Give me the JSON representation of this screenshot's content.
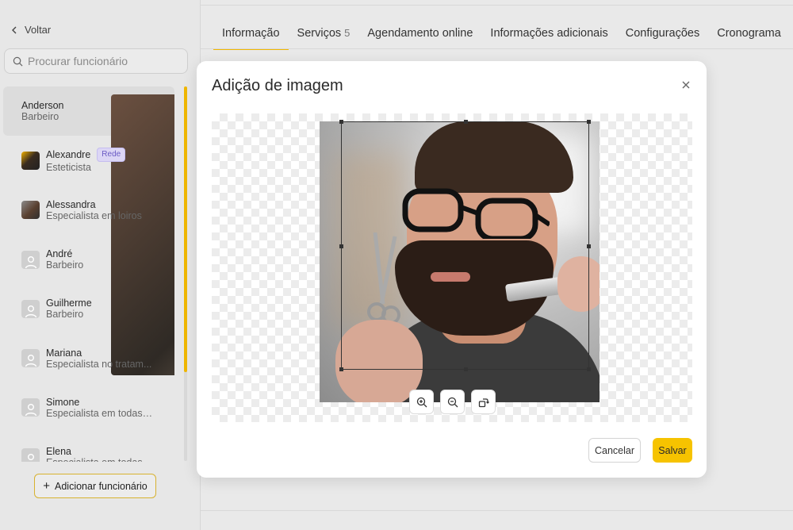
{
  "sidebar": {
    "back_label": "Voltar",
    "search_placeholder": "Procurar funcionário",
    "employees": [
      {
        "name": "Anderson",
        "role": "Barbeiro",
        "badge": ""
      },
      {
        "name": "Alexandre",
        "role": "Esteticista",
        "badge": "Rede"
      },
      {
        "name": "Alessandra",
        "role": "Especialista em loiros",
        "badge": ""
      },
      {
        "name": "André",
        "role": "Barbeiro",
        "badge": ""
      },
      {
        "name": "Guilherme",
        "role": "Barbeiro",
        "badge": ""
      },
      {
        "name": "Mariana",
        "role": "Especialista no tratam...",
        "badge": ""
      },
      {
        "name": "Simone",
        "role": "Especialista em todas ...",
        "badge": ""
      },
      {
        "name": "Elena",
        "role": "Especialista em todas",
        "badge": ""
      }
    ],
    "add_button_label": "Adicionar funcionário"
  },
  "tabs": [
    {
      "label": "Informação",
      "count": ""
    },
    {
      "label": "Serviços",
      "count": "5"
    },
    {
      "label": "Agendamento online",
      "count": ""
    },
    {
      "label": "Informações adicionais",
      "count": ""
    },
    {
      "label": "Configurações",
      "count": ""
    },
    {
      "label": "Cronograma",
      "count": ""
    }
  ],
  "modal": {
    "title": "Adição de imagem",
    "cancel_label": "Cancelar",
    "save_label": "Salvar",
    "tools": [
      "zoom-in-icon",
      "zoom-out-icon",
      "rotate-icon"
    ]
  },
  "colors": {
    "accent": "#f0b700",
    "save_button": "#f6c300",
    "badge_bg": "#dcd6f5",
    "badge_text": "#6a5bc4"
  }
}
